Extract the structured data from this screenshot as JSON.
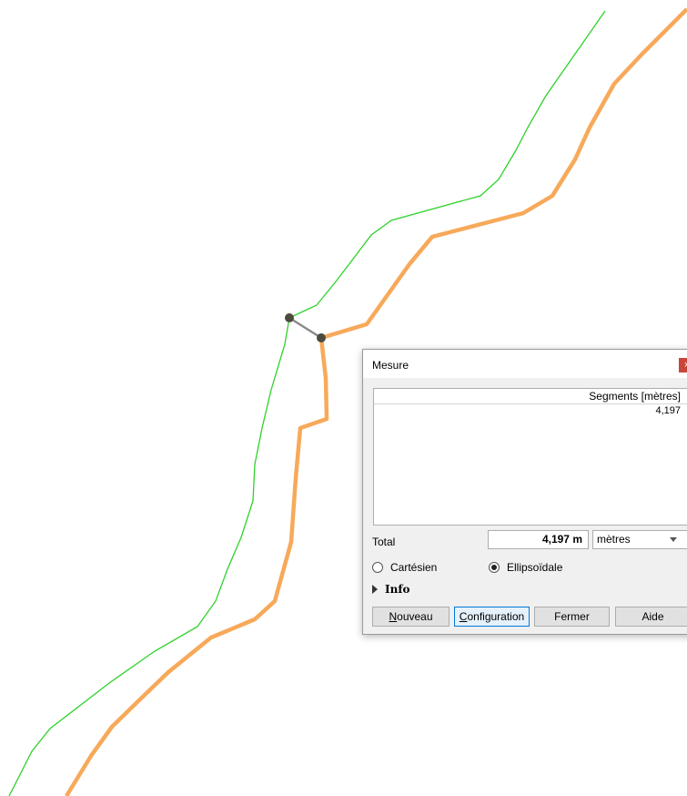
{
  "map": {
    "green_line_color": "#2fd12b",
    "orange_line_color": "#f7a95a",
    "measure_line_color": "#8a8a8a",
    "vertex_color": "#4d4a3e"
  },
  "dialog": {
    "title": "Mesure",
    "close_icon": "close-icon",
    "close_glyph": "×",
    "table": {
      "header": "Segments [mètres]",
      "rows": [
        "4,197"
      ]
    },
    "total": {
      "label": "Total",
      "value": "4,197 m",
      "unit": "mètres"
    },
    "radios": {
      "cartesian_label": "Cartésien",
      "ellipsoidal_label": "Ellipsoïdale",
      "selected": "Ellipsoïdale"
    },
    "info_label": "Info",
    "buttons": {
      "new_first": "N",
      "new_rest": "ouveau",
      "config_first": "C",
      "config_rest": "onfiguration",
      "close": "Fermer",
      "help": "Aide"
    }
  }
}
